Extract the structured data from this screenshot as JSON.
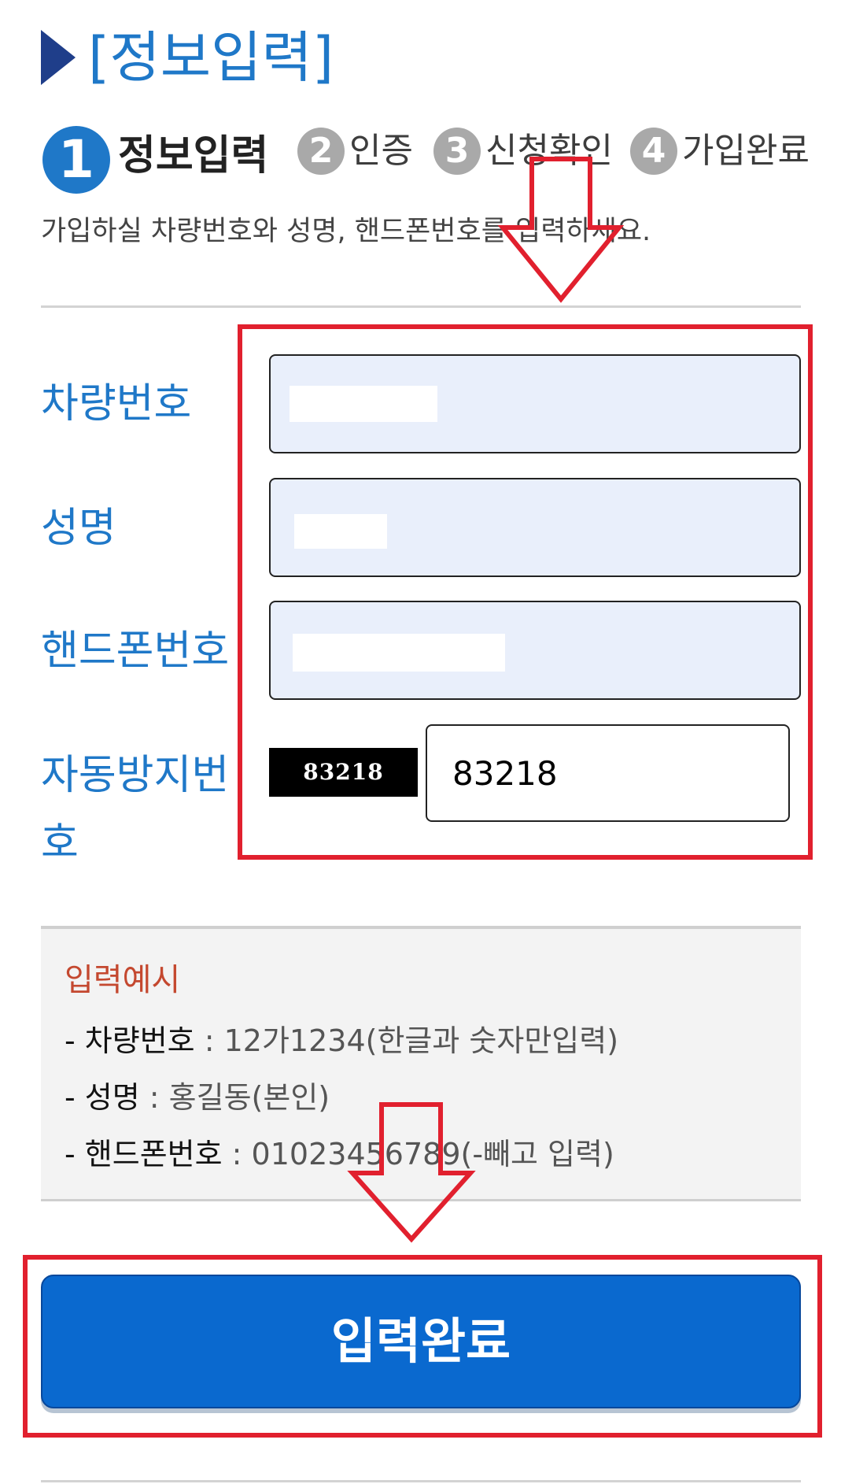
{
  "header": {
    "page_title": "[정보입력]"
  },
  "steps": [
    {
      "number": "1",
      "label": "정보입력"
    },
    {
      "number": "2",
      "label": "인증"
    },
    {
      "number": "3",
      "label": "신청확인"
    },
    {
      "number": "4",
      "label": "가입완료"
    }
  ],
  "instruction": "가입하실 차량번호와 성명, 핸드폰번호를 입력하세요.",
  "form": {
    "car_number_label": "차량번호",
    "name_label": "성명",
    "phone_label": "핸드폰번호",
    "captcha_label_line1": "자동방지번",
    "captcha_label_line2": "호",
    "captcha_image_text": "83218",
    "captcha_value": "83218"
  },
  "example": {
    "title": "입력예시",
    "lines": [
      {
        "key": "- 차량번호",
        "value": " : 12가1234(한글과 숫자만입력)"
      },
      {
        "key": "- 성명",
        "value": " : 홍길동(본인)"
      },
      {
        "key": "- 핸드폰번호",
        "value": " : 01023456789(-빼고 입력)"
      }
    ]
  },
  "submit_label": "입력완료",
  "colors": {
    "accent_blue": "#1f78c8",
    "button_blue": "#0a69cf",
    "annotation_red": "#e1202e",
    "example_title": "#c4482f",
    "step_inactive": "#a9a9a9"
  }
}
